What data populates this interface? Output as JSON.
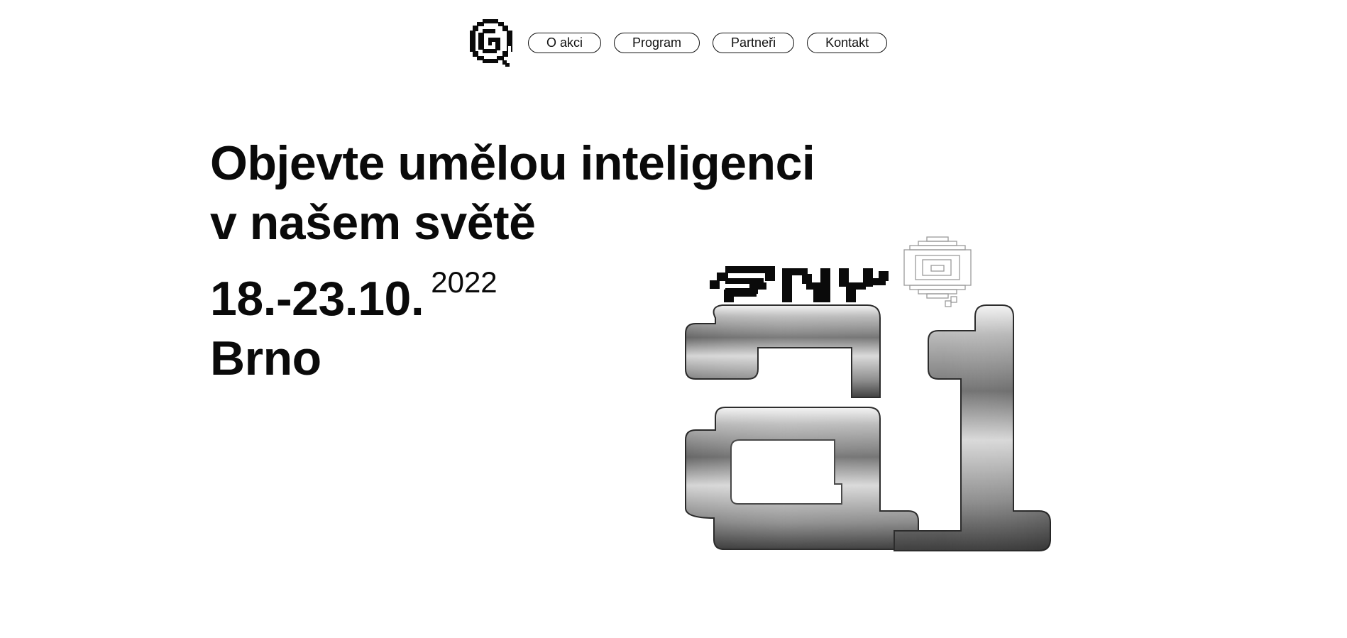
{
  "nav": {
    "logo_icon": "pixel-spiral-icon",
    "items": [
      {
        "label": "O akci"
      },
      {
        "label": "Program"
      },
      {
        "label": "Partneři"
      },
      {
        "label": "Kontakt"
      }
    ]
  },
  "hero": {
    "line1": "Objevte umělou inteligenci",
    "line2": "v našem světě",
    "dates": "18.-23.10.",
    "year": "2022",
    "city": "Brno"
  },
  "brand": {
    "wordmark_text": "dny ai",
    "wordmark_icon": "pixel-dny-wordmark",
    "spiral_icon": "outline-spiral-icon",
    "ai_logo_icon": "chrome-ai-logo",
    "colors": {
      "text": "#0a0a0a",
      "background": "#ffffff",
      "chrome": "#9a9a9a"
    }
  }
}
